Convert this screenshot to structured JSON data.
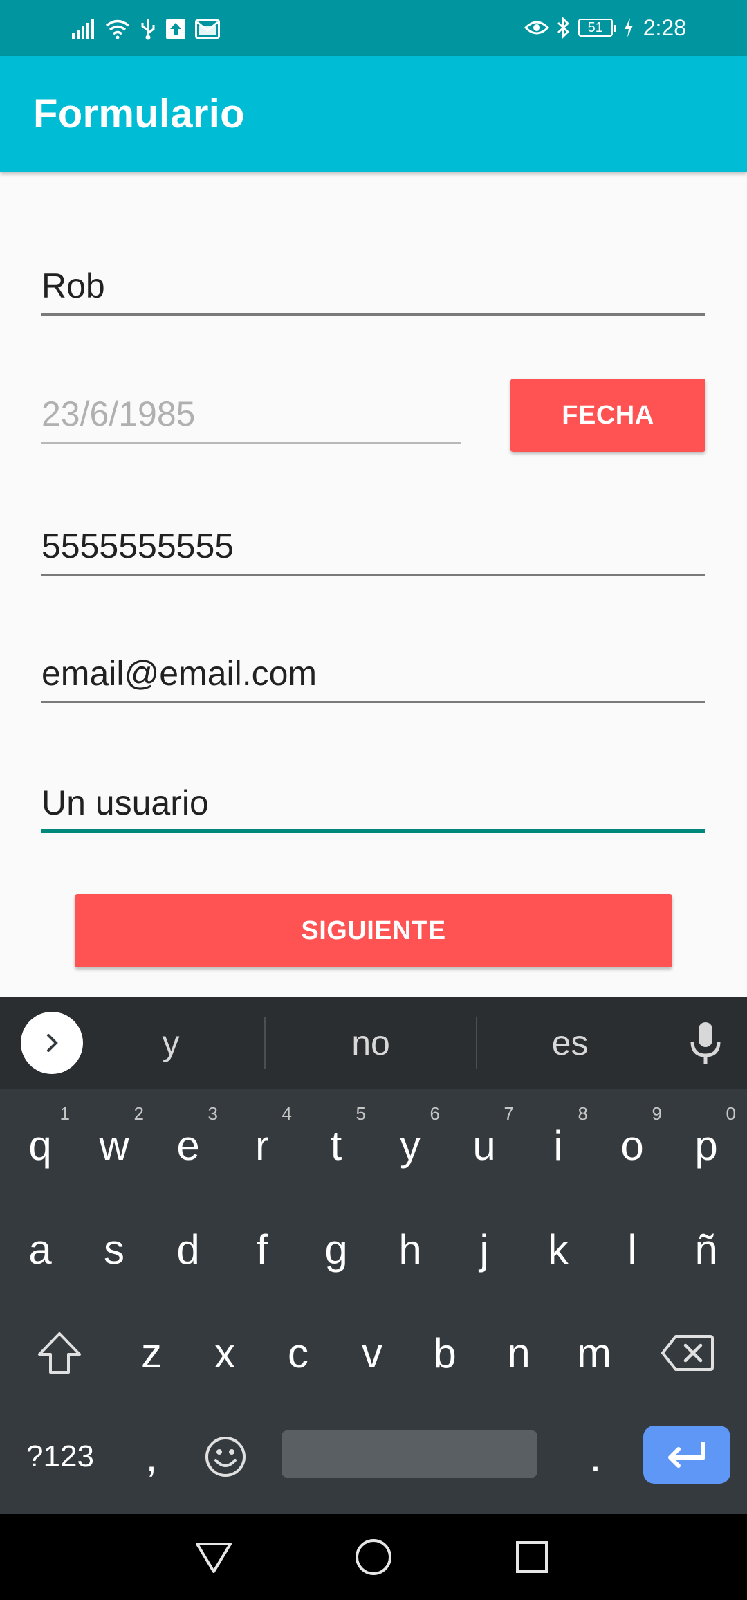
{
  "status_bar": {
    "icons": [
      "signal-icon",
      "wifi-icon",
      "usb-icon",
      "upload-icon",
      "gmail-icon",
      "eye-icon",
      "bluetooth-icon",
      "battery-icon",
      "charging-icon"
    ],
    "battery": "51",
    "time": "2:28"
  },
  "app_bar": {
    "title": "Formulario"
  },
  "form": {
    "name_value": "Rob",
    "date_placeholder": "23/6/1985",
    "date_button": "FECHA",
    "phone_value": "5555555555",
    "email_value": "email@email.com",
    "description_value": "Un usuario",
    "next_button": "SIGUIENTE"
  },
  "keyboard": {
    "suggestions": [
      "y",
      "no",
      "es"
    ],
    "row1": [
      {
        "k": "q",
        "h": "1"
      },
      {
        "k": "w",
        "h": "2"
      },
      {
        "k": "e",
        "h": "3"
      },
      {
        "k": "r",
        "h": "4"
      },
      {
        "k": "t",
        "h": "5"
      },
      {
        "k": "y",
        "h": "6"
      },
      {
        "k": "u",
        "h": "7"
      },
      {
        "k": "i",
        "h": "8"
      },
      {
        "k": "o",
        "h": "9"
      },
      {
        "k": "p",
        "h": "0"
      }
    ],
    "row2": [
      "a",
      "s",
      "d",
      "f",
      "g",
      "h",
      "j",
      "k",
      "l",
      "ñ"
    ],
    "row3": [
      "z",
      "x",
      "c",
      "v",
      "b",
      "n",
      "m"
    ],
    "symbols_key": "?123",
    "comma_key": ",",
    "period_key": ".",
    "colors": {
      "background": "#353a3e",
      "suggest_bar": "#2a2e31",
      "enter": "#5e97f6"
    }
  },
  "colors": {
    "status_bar": "#00959f",
    "app_bar": "#00bcd4",
    "accent_button": "#ff5252",
    "focus_line": "#00897b"
  },
  "nav_bar": {
    "icons": [
      "back-icon",
      "home-icon",
      "recents-icon"
    ]
  }
}
